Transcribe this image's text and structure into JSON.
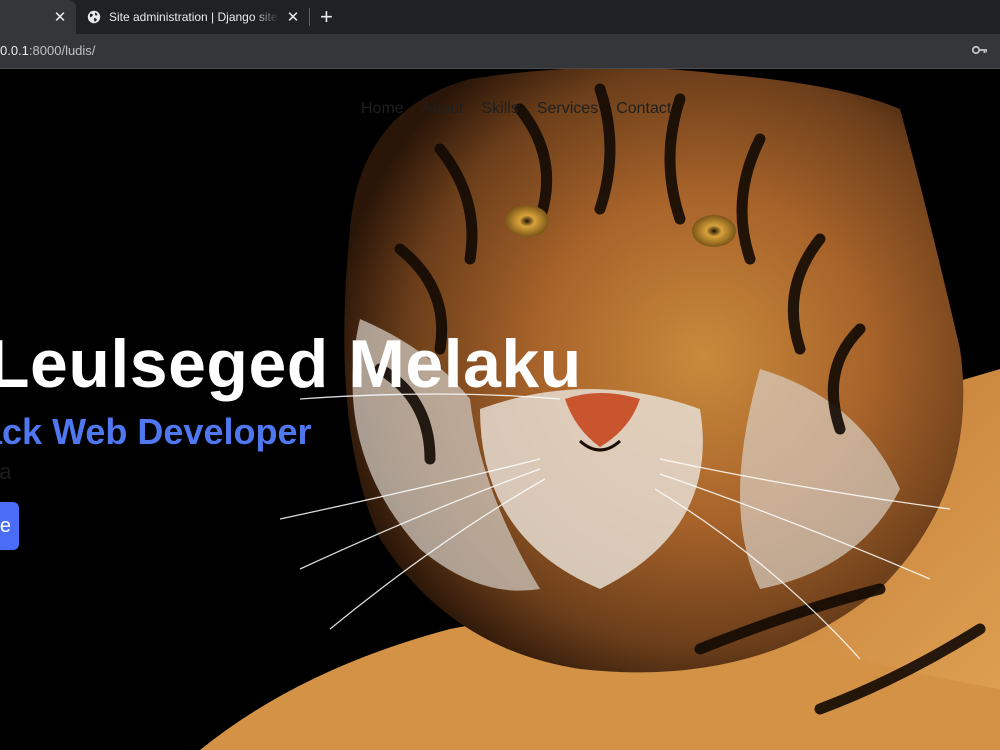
{
  "browser": {
    "tabs": [
      {
        "title": "",
        "active": false
      },
      {
        "title": "Site administration | Django site admin",
        "active": true
      }
    ],
    "url": {
      "host": "0.0.1",
      "rest": ":8000/ludis/"
    }
  },
  "nav": {
    "items": [
      "Home",
      "About",
      "Skills",
      "Services",
      "Contact"
    ]
  },
  "hero": {
    "name": "Leulseged Melaku",
    "role": "ack Web Developer",
    "location": "opia",
    "button_label": "e"
  },
  "colors": {
    "accent": "#4a6cf7",
    "role_text": "#4f77ef"
  },
  "icons": {
    "tab_favicon": "globe-icon",
    "password": "key-icon"
  }
}
